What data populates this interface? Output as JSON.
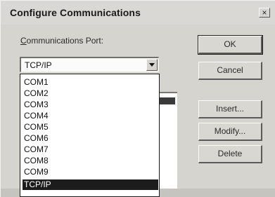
{
  "window": {
    "title": "Configure Communications",
    "close_glyph": "×"
  },
  "port": {
    "label_underlined": "C",
    "label_rest": "ommunications Port:",
    "selected_value": "TCP/IP"
  },
  "dropdown": {
    "items": [
      "COM1",
      "COM2",
      "COM3",
      "COM4",
      "COM5",
      "COM6",
      "COM7",
      "COM8",
      "COM9",
      "TCP/IP"
    ],
    "selected_index": 9
  },
  "buttons": {
    "ok": "OK",
    "cancel": "Cancel",
    "insert": "Insert...",
    "modify": "Modify...",
    "delete": "Delete"
  }
}
